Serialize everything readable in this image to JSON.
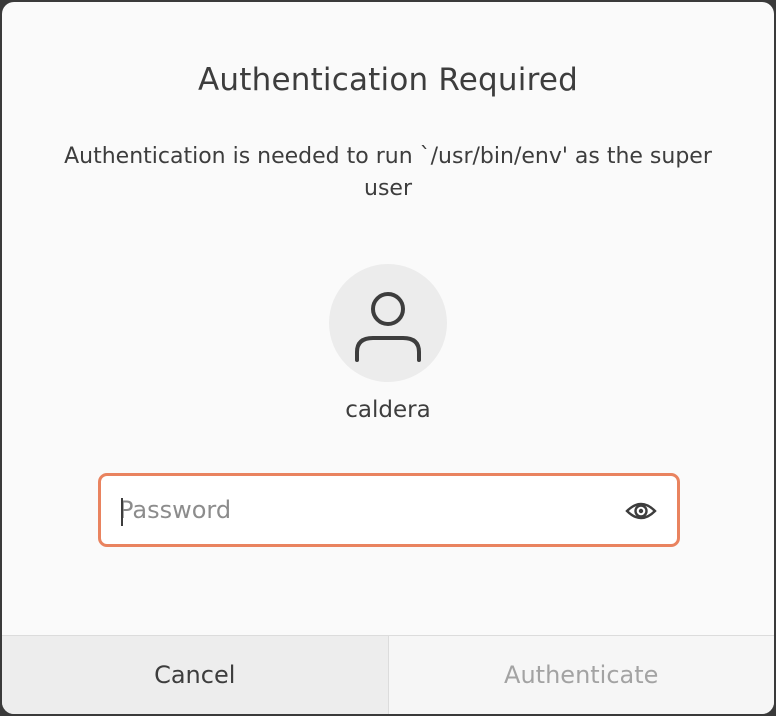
{
  "dialog": {
    "title": "Authentication Required",
    "message": "Authentication is needed to run `/usr/bin/env' as the super user",
    "user": {
      "avatar_icon": "person-icon",
      "name": "caldera"
    },
    "password": {
      "value": "",
      "placeholder": "Password",
      "reveal_icon": "eye-icon"
    },
    "buttons": {
      "cancel_label": "Cancel",
      "authenticate_label": "Authenticate"
    },
    "colors": {
      "focus_border": "#e9835f",
      "disabled_text": "#a3a3a3"
    }
  }
}
